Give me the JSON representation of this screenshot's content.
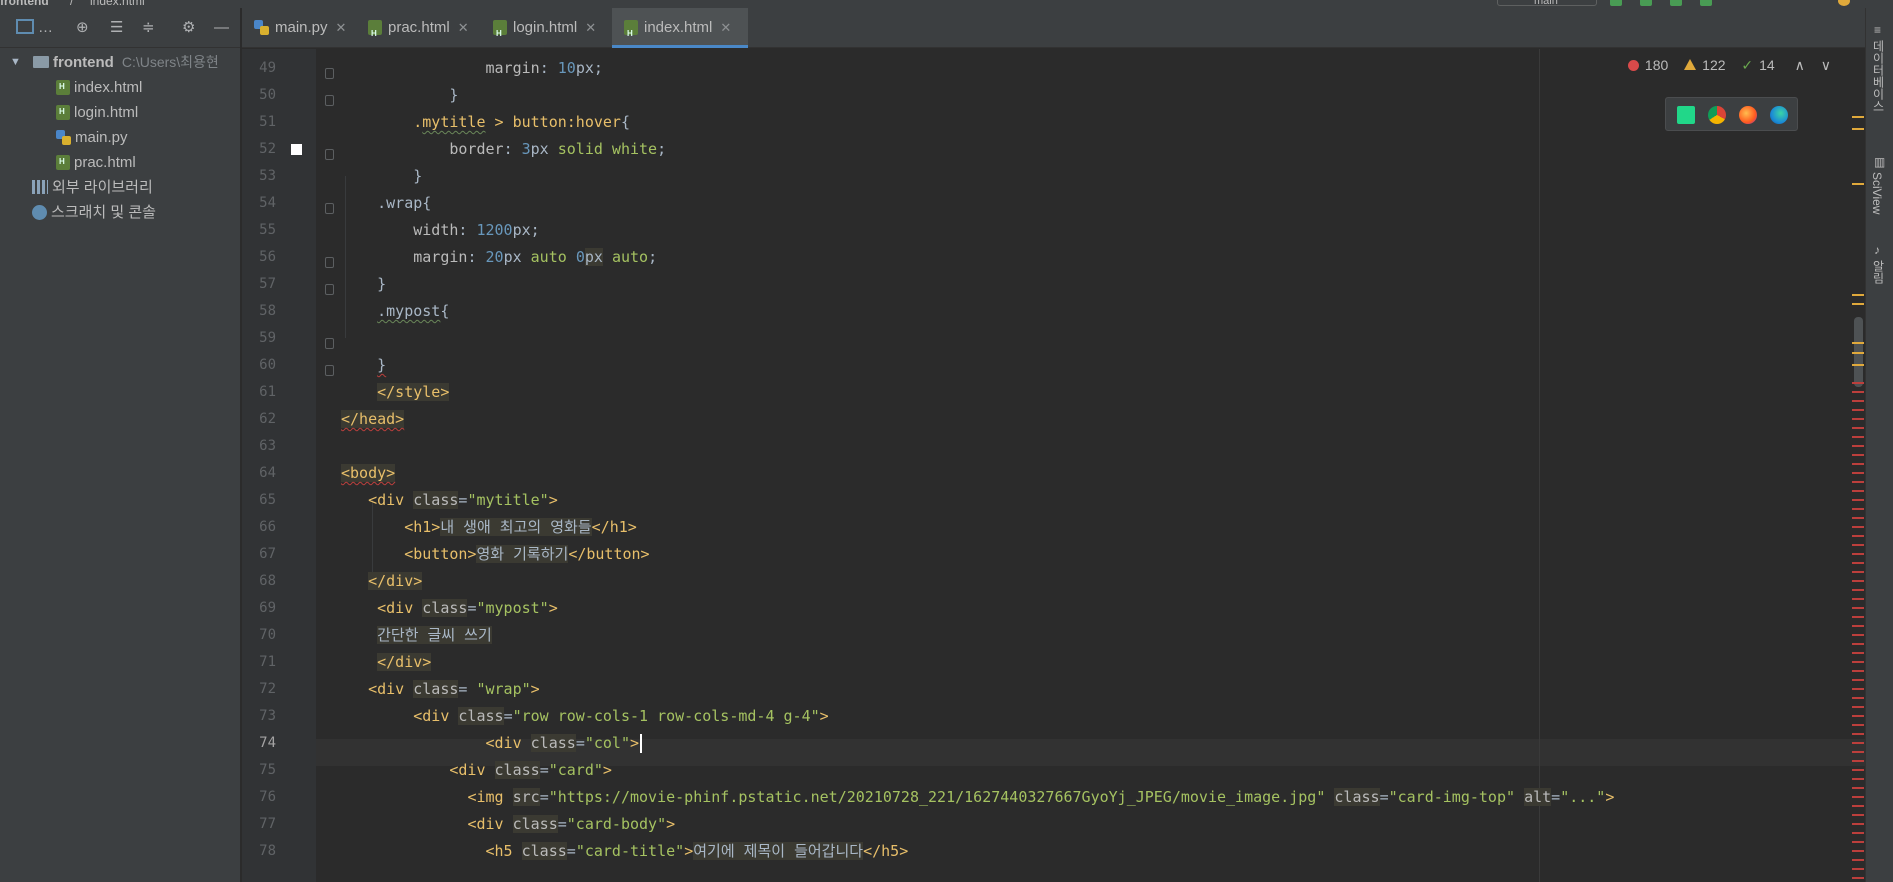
{
  "window": {
    "breadcrumb": [
      "frontend",
      "/",
      "index.html"
    ],
    "run_config": "main"
  },
  "project": {
    "root": {
      "name": "frontend",
      "path": "C:\\Users\\최용현"
    },
    "files": [
      {
        "name": "index.html",
        "icon": "html-file-icon"
      },
      {
        "name": "login.html",
        "icon": "html-file-icon"
      },
      {
        "name": "main.py",
        "icon": "python-file-icon"
      },
      {
        "name": "prac.html",
        "icon": "html-file-icon"
      }
    ],
    "external_libraries": "외부 라이브러리",
    "scratches": "스크래치 및 콘솔"
  },
  "tabs": [
    {
      "label": "main.py",
      "icon": "python-file-icon",
      "active": false
    },
    {
      "label": "prac.html",
      "icon": "html-file-icon",
      "active": false
    },
    {
      "label": "login.html",
      "icon": "html-file-icon",
      "active": false
    },
    {
      "label": "index.html",
      "icon": "html-file-icon",
      "active": true
    }
  ],
  "inspections": {
    "errors": "180",
    "warnings": "122",
    "weak_warnings": "14"
  },
  "editor": {
    "current_line": "74",
    "lines": [
      {
        "num": "49",
        "text": "                margin: 10px;"
      },
      {
        "num": "50",
        "text": "            }"
      },
      {
        "num": "51",
        "text": "        .mytitle > button:hover{"
      },
      {
        "num": "52",
        "text": "            border: 3px solid white;"
      },
      {
        "num": "53",
        "text": "        }"
      },
      {
        "num": "54",
        "text": "    .wrap{"
      },
      {
        "num": "55",
        "text": "        width: 1200px;"
      },
      {
        "num": "56",
        "text": "        margin: 20px auto 0px auto;"
      },
      {
        "num": "57",
        "text": "    }"
      },
      {
        "num": "58",
        "text": "    .mypost{"
      },
      {
        "num": "59",
        "text": ""
      },
      {
        "num": "60",
        "text": "    }"
      },
      {
        "num": "61",
        "text": "    </style>"
      },
      {
        "num": "62",
        "text": "</head>"
      },
      {
        "num": "63",
        "text": ""
      },
      {
        "num": "64",
        "text": "<body>"
      },
      {
        "num": "65",
        "text": "   <div class=\"mytitle\">"
      },
      {
        "num": "66",
        "text": "       <h1>내 생애 최고의 영화들</h1>"
      },
      {
        "num": "67",
        "text": "       <button>영화 기록하기</button>"
      },
      {
        "num": "68",
        "text": "   </div>"
      },
      {
        "num": "69",
        "text": "    <div class=\"mypost\">"
      },
      {
        "num": "70",
        "text": "    간단한 글씨 쓰기"
      },
      {
        "num": "71",
        "text": "    </div>"
      },
      {
        "num": "72",
        "text": "   <div class= \"wrap\">"
      },
      {
        "num": "73",
        "text": "        <div class=\"row row-cols-1 row-cols-md-4 g-4\">"
      },
      {
        "num": "74",
        "text": "                <div class=\"col\">"
      },
      {
        "num": "75",
        "text": "            <div class=\"card\">"
      },
      {
        "num": "76",
        "text": "              <img src=\"https://movie-phinf.pstatic.net/20210728_221/1627440327667GyoYj_JPEG/movie_image.jpg\" class=\"card-img-top\" alt=\"...\">"
      },
      {
        "num": "77",
        "text": "              <div class=\"card-body\">"
      },
      {
        "num": "78",
        "text": "                <h5 class=\"card-title\">여기에 제목이 들어갑니다</h5>"
      }
    ]
  },
  "right_tools": [
    "데이터베이스",
    "SciView",
    "알림"
  ],
  "colors": {
    "accent": "#4a88c7",
    "error": "#d94a4a",
    "warning": "#e0a93b",
    "background": "#2b2b2b"
  }
}
